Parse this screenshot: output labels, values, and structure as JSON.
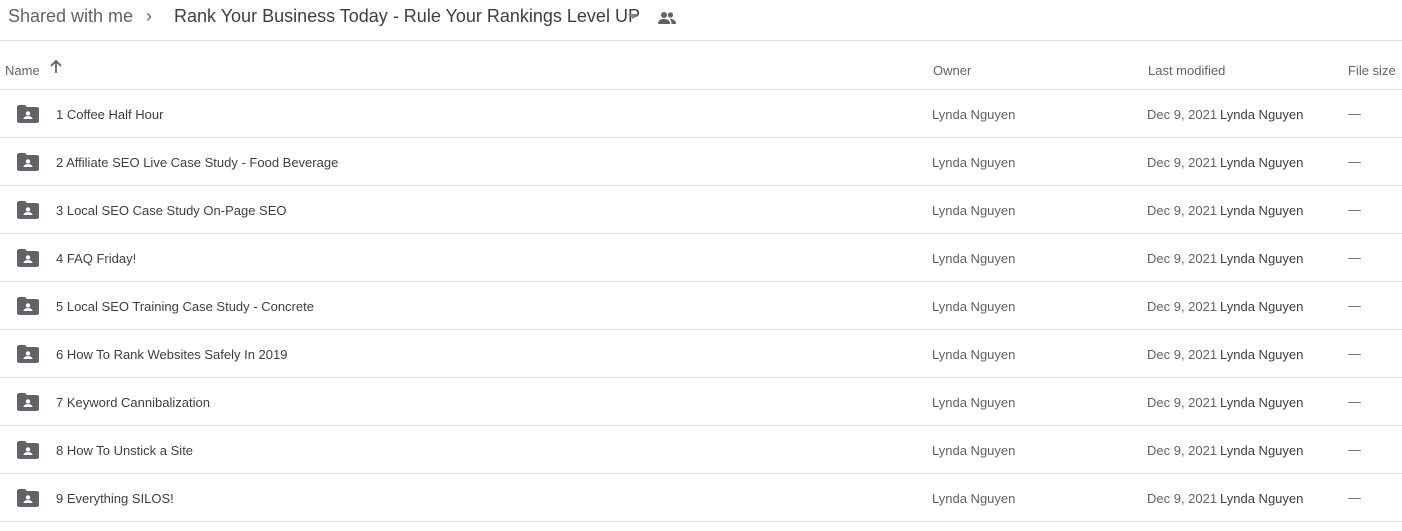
{
  "breadcrumb": {
    "root": "Shared with me",
    "separator": "›",
    "current": "Rank Your Business Today - Rule Your Rankings Level UP"
  },
  "columns": {
    "name": "Name",
    "sort_icon": "arrow-up-icon",
    "owner": "Owner",
    "last_modified": "Last modified",
    "file_size": "File size"
  },
  "rows": [
    {
      "name": "1 Coffee Half Hour",
      "owner": "Lynda Nguyen",
      "date": "Dec 9, 2021",
      "modified_by": "Lynda Nguyen",
      "size": "—"
    },
    {
      "name": "2 Affiliate SEO Live Case Study - Food Beverage",
      "owner": "Lynda Nguyen",
      "date": "Dec 9, 2021",
      "modified_by": "Lynda Nguyen",
      "size": "—"
    },
    {
      "name": "3 Local SEO Case Study On-Page SEO",
      "owner": "Lynda Nguyen",
      "date": "Dec 9, 2021",
      "modified_by": "Lynda Nguyen",
      "size": "—"
    },
    {
      "name": "4 FAQ Friday!",
      "owner": "Lynda Nguyen",
      "date": "Dec 9, 2021",
      "modified_by": "Lynda Nguyen",
      "size": "—"
    },
    {
      "name": "5 Local SEO Training Case Study - Concrete",
      "owner": "Lynda Nguyen",
      "date": "Dec 9, 2021",
      "modified_by": "Lynda Nguyen",
      "size": "—"
    },
    {
      "name": "6 How To Rank Websites Safely In 2019",
      "owner": "Lynda Nguyen",
      "date": "Dec 9, 2021",
      "modified_by": "Lynda Nguyen",
      "size": "—"
    },
    {
      "name": "7 Keyword Cannibalization",
      "owner": "Lynda Nguyen",
      "date": "Dec 9, 2021",
      "modified_by": "Lynda Nguyen",
      "size": "—"
    },
    {
      "name": "8 How To Unstick a Site",
      "owner": "Lynda Nguyen",
      "date": "Dec 9, 2021",
      "modified_by": "Lynda Nguyen",
      "size": "—"
    },
    {
      "name": "9 Everything SILOS!",
      "owner": "Lynda Nguyen",
      "date": "Dec 9, 2021",
      "modified_by": "Lynda Nguyen",
      "size": "—"
    }
  ],
  "colors": {
    "icon": "#5f6368",
    "divider": "#dadce0"
  }
}
